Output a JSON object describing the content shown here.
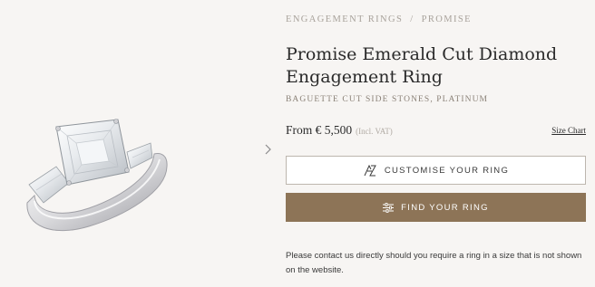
{
  "breadcrumb": {
    "items": [
      "ENGAGEMENT RINGS",
      "PROMISE"
    ],
    "separator": "/"
  },
  "product": {
    "title": "Promise Emerald Cut Diamond Engagement Ring",
    "subtitle": "BAGUETTE CUT SIDE STONES, PLATINUM",
    "price": "From € 5,500",
    "vat_note": "(Incl. VAT)",
    "size_chart_label": "Size Chart"
  },
  "actions": {
    "customise_label": "CUSTOMISE YOUR RING",
    "customise_icon": "monogram-icon",
    "find_label": "FIND YOUR RING",
    "find_icon": "sliders-icon"
  },
  "note": "Please contact us directly should you require a ring in a size that is not shown on the website.",
  "gallery": {
    "next_icon": "chevron-right-icon"
  },
  "colors": {
    "background": "#f7f5f3",
    "accent": "#8d7457",
    "muted_text": "#a8a29b"
  }
}
